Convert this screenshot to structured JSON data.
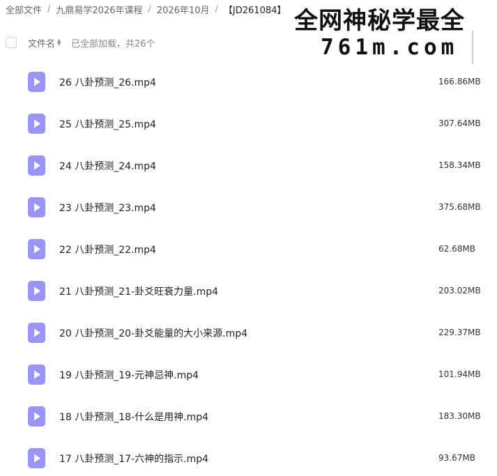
{
  "breadcrumb": {
    "items": [
      "全部文件",
      "九鼎易学2026年课程",
      "2026年10月"
    ],
    "separator": "/",
    "current": "【JD261084】"
  },
  "watermark": {
    "line1": "全网神秘学最全",
    "line2": "761m.com"
  },
  "list_header": {
    "column_name": "文件名",
    "load_status": "已全部加载，共26个"
  },
  "colors": {
    "video_icon": "#9b94f7",
    "text": "#222222",
    "muted": "#666666"
  },
  "files": [
    {
      "name": "26 八卦预测_26.mp4",
      "size": "166.86MB",
      "icon": "video-file-icon"
    },
    {
      "name": "25 八卦预测_25.mp4",
      "size": "307.64MB",
      "icon": "video-file-icon"
    },
    {
      "name": "24 八卦预测_24.mp4",
      "size": "158.34MB",
      "icon": "video-file-icon"
    },
    {
      "name": "23 八卦预测_23.mp4",
      "size": "375.68MB",
      "icon": "video-file-icon"
    },
    {
      "name": "22 八卦预测_22.mp4",
      "size": "62.68MB",
      "icon": "video-file-icon"
    },
    {
      "name": "21 八卦预测_21-卦爻旺衰力量.mp4",
      "size": "203.02MB",
      "icon": "video-file-icon"
    },
    {
      "name": "20 八卦预测_20-卦爻能量的大小来源.mp4",
      "size": "229.37MB",
      "icon": "video-file-icon"
    },
    {
      "name": "19 八卦预测_19-元神忌神.mp4",
      "size": "101.94MB",
      "icon": "video-file-icon"
    },
    {
      "name": "18 八卦预测_18-什么是用神.mp4",
      "size": "183.30MB",
      "icon": "video-file-icon"
    },
    {
      "name": "17 八卦预测_17-六神的指示.mp4",
      "size": "93.67MB",
      "icon": "video-file-icon"
    }
  ]
}
